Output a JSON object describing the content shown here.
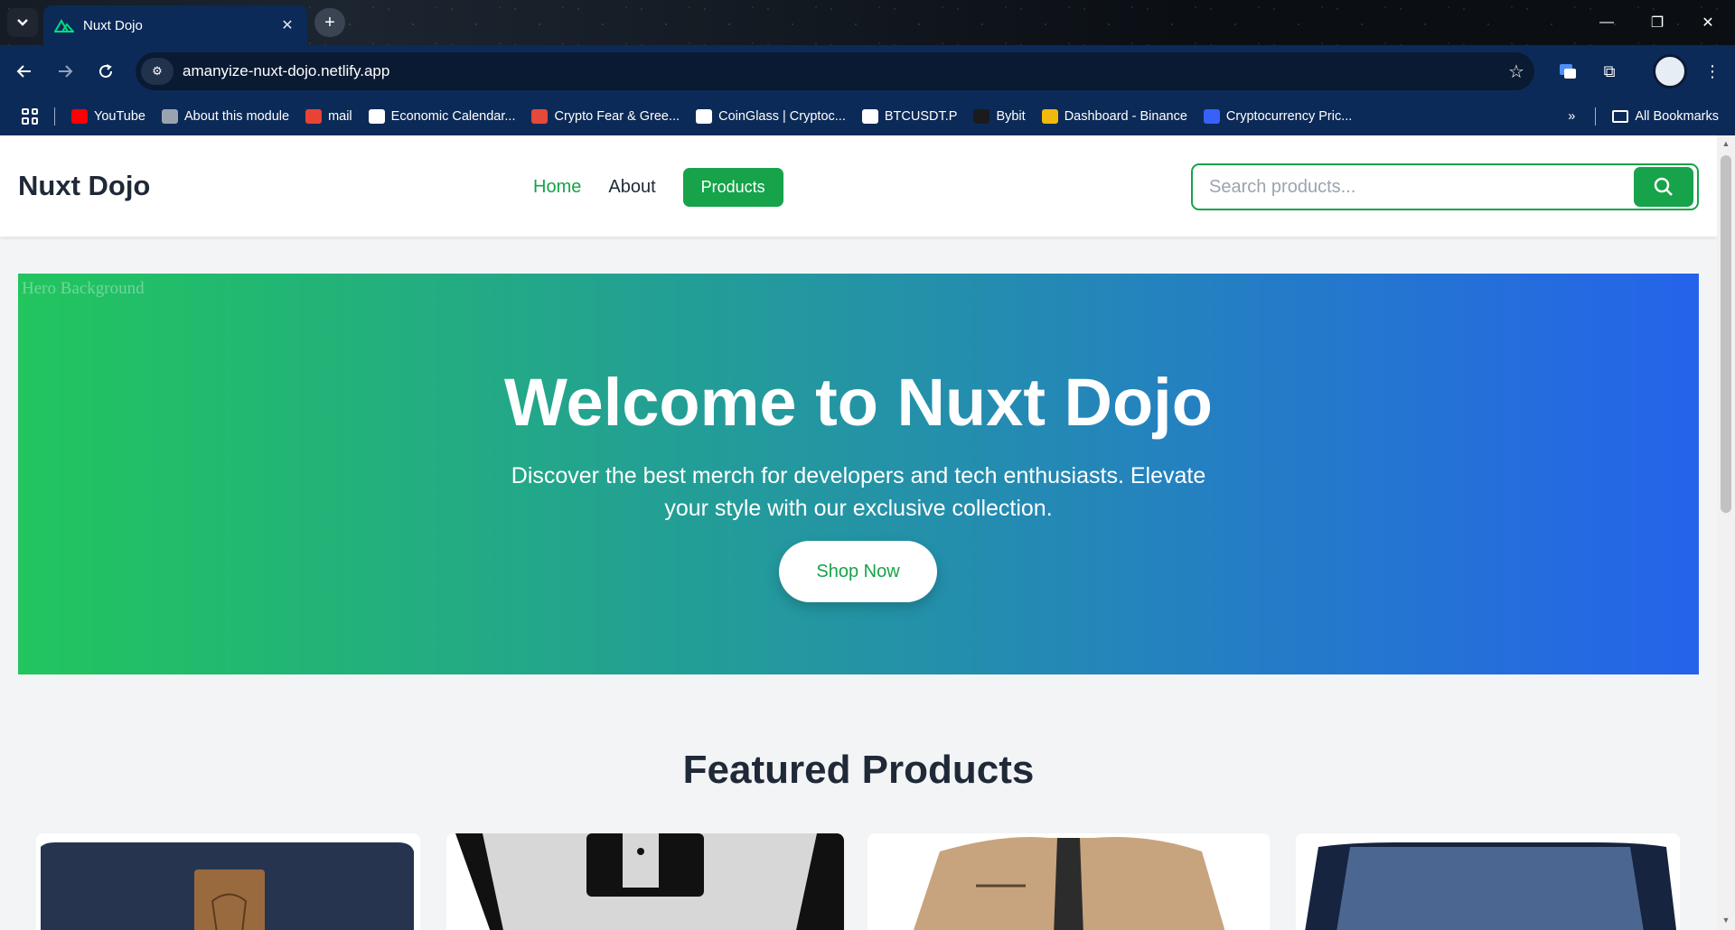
{
  "browser": {
    "tab_title": "Nuxt Dojo",
    "url": "amanyize-nuxt-dojo.netlify.app",
    "bookmarks": [
      {
        "label": "YouTube",
        "icon": "youtube-icon",
        "color": "#ff0000"
      },
      {
        "label": "About this module",
        "icon": "globe-icon",
        "color": "#9aa4b1"
      },
      {
        "label": "mail",
        "icon": "gmail-icon",
        "color": "#ea4335"
      },
      {
        "label": "Economic Calendar...",
        "icon": "tradingview-icon",
        "color": "#ffffff"
      },
      {
        "label": "Crypto Fear & Gree...",
        "icon": "alternative-icon",
        "color": "#e5493a"
      },
      {
        "label": "CoinGlass | Cryptoc...",
        "icon": "coinglass-icon",
        "color": "#ffffff"
      },
      {
        "label": "BTCUSDT.P",
        "icon": "tradingview-icon",
        "color": "#ffffff"
      },
      {
        "label": "Bybit",
        "icon": "bybit-icon",
        "color": "#1b1b1b"
      },
      {
        "label": "Dashboard - Binance",
        "icon": "binance-icon",
        "color": "#f0b90b"
      },
      {
        "label": "Cryptocurrency Pric...",
        "icon": "coinmarketcap-icon",
        "color": "#3861fb"
      }
    ],
    "all_bookmarks": "All Bookmarks"
  },
  "header": {
    "logo": "Nuxt Dojo",
    "nav": {
      "home": "Home",
      "about": "About",
      "products": "Products"
    },
    "search_placeholder": "Search products..."
  },
  "hero": {
    "image_alt": "Hero Background",
    "title": "Welcome to Nuxt Dojo",
    "subtitle": "Discover the best merch for developers and tech enthusiasts. Elevate your style with our exclusive collection.",
    "cta": "Shop Now"
  },
  "featured": {
    "title": "Featured Products"
  },
  "colors": {
    "brand_green": "#16a34a",
    "hero_start": "#22c55e",
    "hero_end": "#2563eb",
    "chrome_blue": "#0c2a57"
  }
}
